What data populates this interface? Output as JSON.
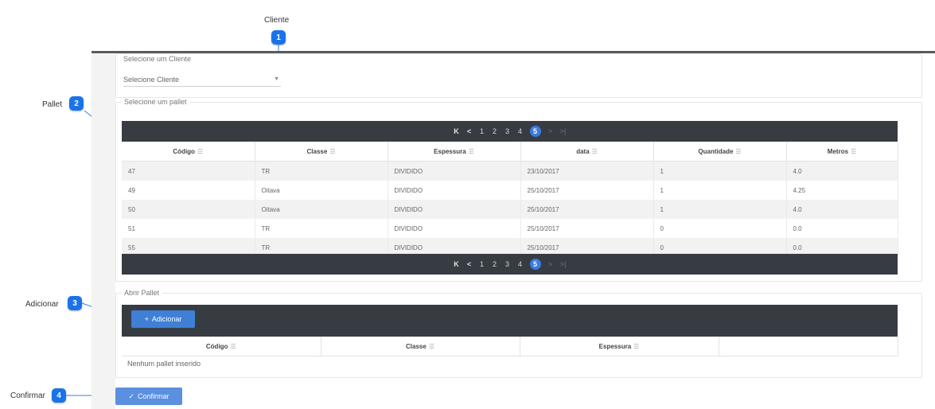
{
  "callouts": {
    "cliente": {
      "label": "Cliente",
      "number": "1"
    },
    "pallet": {
      "label": "Pallet",
      "number": "2"
    },
    "adicionar": {
      "label": "Adicionar",
      "number": "3"
    },
    "confirmar": {
      "label": "Confirmar",
      "number": "4"
    }
  },
  "client": {
    "section_label": "Selecione um Cliente",
    "select_value": "Selecione Cliente",
    "caret_icon": "chevron-down-icon"
  },
  "pallet_section": {
    "legend": "Selecione um pallet",
    "pager": {
      "first": "K",
      "prev": "<",
      "pages": [
        "1",
        "2",
        "3",
        "4",
        "5"
      ],
      "active": "5",
      "next": ">",
      "last": ">|"
    },
    "columns": [
      "Código",
      "Classe",
      "Espessura",
      "data",
      "Quantidade",
      "Metros"
    ],
    "rows": [
      [
        "47",
        "TR",
        "DIVIDIDO",
        "23/10/2017",
        "1",
        "4.0"
      ],
      [
        "49",
        "Oitava",
        "DIVIDIDO",
        "25/10/2017",
        "1",
        "4.25"
      ],
      [
        "50",
        "Oitava",
        "DIVIDIDO",
        "25/10/2017",
        "1",
        "4.0"
      ],
      [
        "51",
        "TR",
        "DIVIDIDO",
        "25/10/2017",
        "0",
        "0.0"
      ],
      [
        "55",
        "TR",
        "DIVIDIDO",
        "25/10/2017",
        "0",
        "0.0"
      ]
    ]
  },
  "abrir_section": {
    "legend": "Abrir Pallet",
    "add_button": "Adicionar",
    "add_icon": "plus-icon",
    "columns": [
      "Código",
      "Classe",
      "Espessura",
      ""
    ],
    "empty_message": "Nenhum pallet inserido"
  },
  "confirm": {
    "label": "Confirmar",
    "icon": "check-icon"
  },
  "colors": {
    "accent": "#3f7fd6",
    "badge": "#1a73e8",
    "dark_bar": "#373c43"
  }
}
